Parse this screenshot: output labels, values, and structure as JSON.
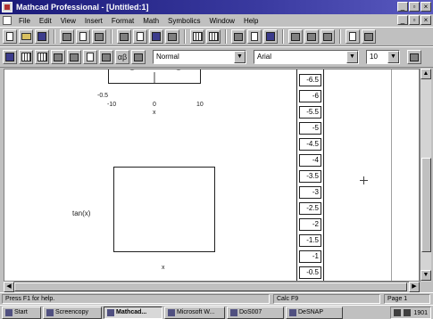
{
  "window": {
    "title": "Mathcad Professional - [Untitled:1]",
    "minimize_glyph": "_",
    "maximize_glyph": "▫",
    "close_glyph": "×",
    "doc_minimize_glyph": "_",
    "doc_maximize_glyph": "▫",
    "doc_close_glyph": "×"
  },
  "menu": {
    "items": [
      "File",
      "Edit",
      "View",
      "Insert",
      "Format",
      "Math",
      "Symbolics",
      "Window",
      "Help"
    ]
  },
  "toolbar2": {
    "style_value": "Normal",
    "font_value": "Arial",
    "size_value": "10",
    "arrow_glyph": "▼",
    "alpha_beta_label": "αβ"
  },
  "icons": {
    "new": "new-document-icon",
    "open": "open-folder-icon",
    "save": "save-disk-icon",
    "print": "print-icon",
    "calculator": "calculator-palette-icon",
    "graph": "graph-palette-icon",
    "matrix": "matrix-palette-icon",
    "calculus": "calculus-palette-icon",
    "greek": "greek-palette-icon",
    "programming": "programming-palette-icon"
  },
  "worksheet": {
    "plot1": {
      "y_tick": "-0.5",
      "x_ticks": [
        "-10",
        "0",
        "10"
      ],
      "x_label": "x"
    },
    "plot2": {
      "y_label": "tan(x)",
      "x_label": "x"
    },
    "table_values": [
      "-6.5",
      "-6",
      "-5.5",
      "-5",
      "-4.5",
      "-4",
      "-3.5",
      "-3",
      "-2.5",
      "-2",
      "-1.5",
      "-1",
      "-0.5"
    ]
  },
  "scroll": {
    "up": "▲",
    "down": "▼",
    "left": "◀",
    "right": "▶"
  },
  "status": {
    "left": "Press F1 for help.",
    "middle": "Calc F9",
    "right": "Page 1"
  },
  "taskbar": {
    "start_label": "Start",
    "tasks": [
      {
        "label": "Screencopy"
      },
      {
        "label": "Mathcad..."
      },
      {
        "label": "Microsoft W..."
      },
      {
        "label": "DoS007"
      },
      {
        "label": "DeSNAP"
      }
    ],
    "clock": "1901"
  }
}
